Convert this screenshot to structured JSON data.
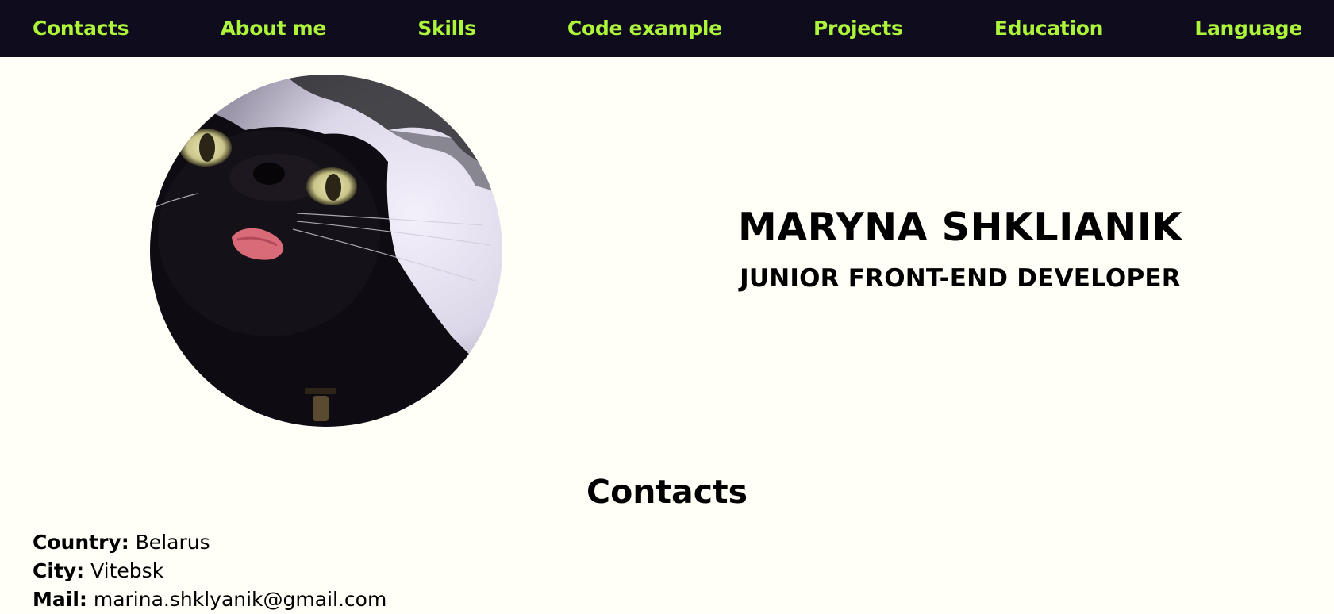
{
  "nav": {
    "items": [
      {
        "label": "Contacts"
      },
      {
        "label": "About me"
      },
      {
        "label": "Skills"
      },
      {
        "label": "Code example"
      },
      {
        "label": "Projects"
      },
      {
        "label": "Education"
      },
      {
        "label": "Language"
      }
    ]
  },
  "header": {
    "name": "MARYNA SHKLIANIK",
    "role": "JUNIOR FRONT-END DEVELOPER",
    "avatar_icon": "profile-photo-black-cat"
  },
  "contacts": {
    "title": "Contacts",
    "items": [
      {
        "key": "Country:",
        "value": "Belarus"
      },
      {
        "key": "City:",
        "value": "Vitebsk"
      },
      {
        "key": "Mail:",
        "value": "marina.shklyanik@gmail.com"
      }
    ]
  },
  "colors": {
    "nav_background": "#0f0c1e",
    "nav_link": "#adf53b",
    "page_background": "#fffff7",
    "text": "#000000"
  }
}
